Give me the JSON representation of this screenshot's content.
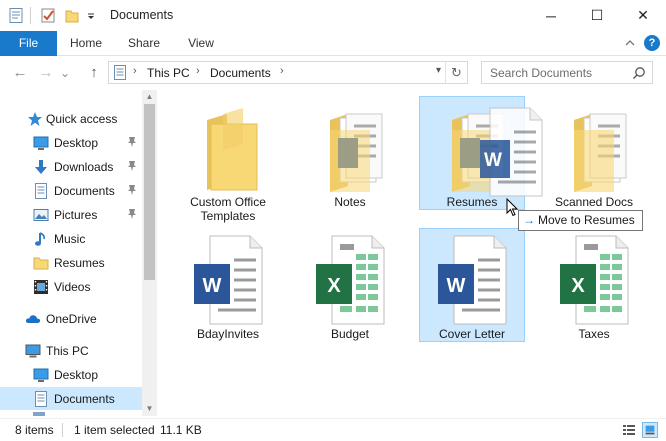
{
  "window": {
    "title": "Documents",
    "minimize_glyph": "─",
    "maximize_glyph": "☐",
    "close_glyph": "✕"
  },
  "quick_access_toolbar": {
    "icons": [
      "properties-icon",
      "checkmark-icon",
      "new-folder-icon",
      "customize-dropdown-icon"
    ]
  },
  "ribbon": {
    "tabs": [
      {
        "label": "File",
        "active": true
      },
      {
        "label": "Home"
      },
      {
        "label": "Share"
      },
      {
        "label": "View"
      }
    ],
    "help_glyph": "?"
  },
  "nav": {
    "back_glyph": "←",
    "forward_glyph": "→",
    "recent_glyph": "⌄",
    "up_glyph": "↑",
    "breadcrumb": [
      "This PC",
      "Documents"
    ],
    "search_placeholder": "Search Documents"
  },
  "sidebar": {
    "items": [
      {
        "label": "Quick access",
        "icon": "star-icon"
      },
      {
        "label": "Desktop",
        "icon": "desktop-icon",
        "pinned": true
      },
      {
        "label": "Downloads",
        "icon": "downloads-icon",
        "pinned": true
      },
      {
        "label": "Documents",
        "icon": "documents-icon",
        "pinned": true
      },
      {
        "label": "Pictures",
        "icon": "pictures-icon",
        "pinned": true
      },
      {
        "label": "Music",
        "icon": "music-icon"
      },
      {
        "label": "Resumes",
        "icon": "folder-icon"
      },
      {
        "label": "Videos",
        "icon": "videos-icon"
      },
      {
        "label": "OneDrive",
        "icon": "cloud-icon"
      },
      {
        "label": "This PC",
        "icon": "computer-icon"
      },
      {
        "label": "Desktop",
        "icon": "desktop-icon"
      },
      {
        "label": "Documents",
        "icon": "documents-icon",
        "selected": true
      }
    ]
  },
  "files": [
    {
      "name": "Custom Office Templates",
      "type": "folder"
    },
    {
      "name": "Notes",
      "type": "folder-with-word"
    },
    {
      "name": "Resumes",
      "type": "folder-with-word",
      "drop_target": true
    },
    {
      "name": "Scanned Docs",
      "type": "folder-with-docs"
    },
    {
      "name": "BdayInvites",
      "type": "word"
    },
    {
      "name": "Budget",
      "type": "excel"
    },
    {
      "name": "Cover Letter",
      "type": "word",
      "selected": true
    },
    {
      "name": "Taxes",
      "type": "excel"
    }
  ],
  "drag": {
    "tooltip": "Move to Resumes"
  },
  "status": {
    "item_count": "8 items",
    "selection": "1 item selected",
    "size": "11.1 KB"
  },
  "colors": {
    "accent": "#1979ca",
    "selection": "#cce8ff",
    "word_blue": "#2b579a",
    "excel_green": "#217346",
    "folder_yellow": "#f8d775"
  }
}
